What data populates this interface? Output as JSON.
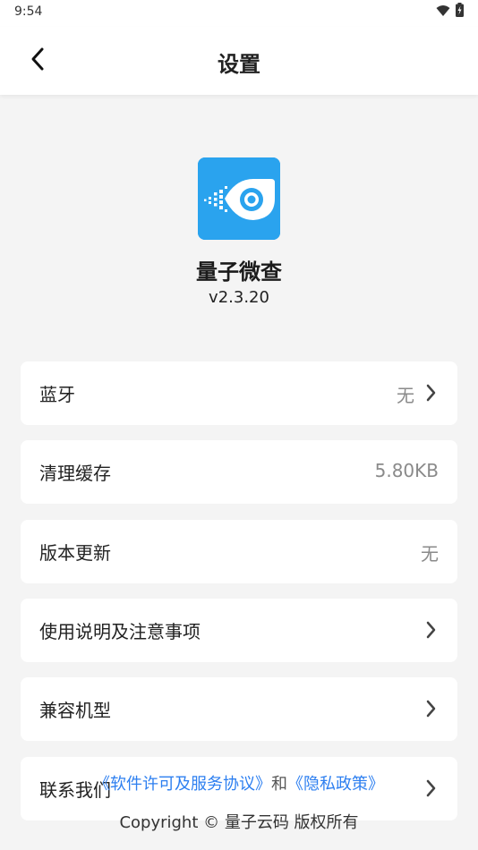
{
  "status_bar": {
    "time": "9:54"
  },
  "header": {
    "title": "设置",
    "back_icon": "chevron-left-icon"
  },
  "app": {
    "name": "量子微查",
    "version": "v2.3.20",
    "logo_color": "#2aa3ee"
  },
  "settings": {
    "bluetooth": {
      "label": "蓝牙",
      "value": "无"
    },
    "clear_cache": {
      "label": "清理缓存",
      "value": "5.80KB"
    },
    "version_update": {
      "label": "版本更新",
      "value": "无"
    },
    "instructions": {
      "label": "使用说明及注意事项"
    },
    "compatible_models": {
      "label": "兼容机型"
    },
    "contact_us": {
      "label": "联系我们"
    }
  },
  "footer": {
    "license_link": "《软件许可及服务协议》",
    "separator": "和",
    "privacy_link": "《隐私政策》",
    "copyright": "Copyright © 量子云码 版权所有"
  },
  "colors": {
    "link": "#2d7ff0",
    "background": "#f4f4f4"
  }
}
